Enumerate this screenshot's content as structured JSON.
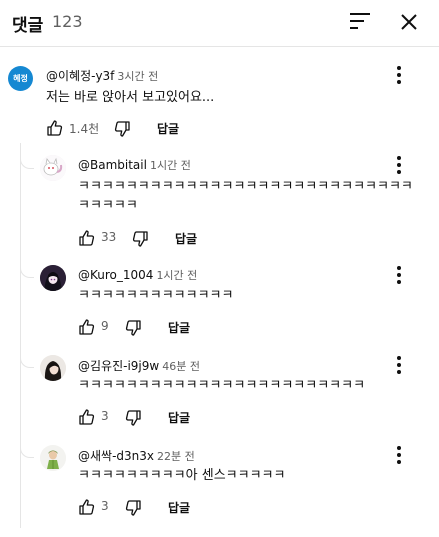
{
  "header": {
    "title": "댓글",
    "count": "123"
  },
  "main_comment": {
    "avatar_text": "혜정",
    "author": "@이혜정-y3f",
    "time": "3시간 전",
    "text": "저는 바로 앉아서 보고있어요...",
    "likes": "1.4천",
    "reply_label": "답글"
  },
  "replies": [
    {
      "author": "@Bambitail",
      "time": "1시간 전",
      "text_line1": "ㅋㅋㅋㅋㅋㅋㅋㅋㅋㅋㅋㅋㅋㅋㅋㅋㅋㅋㅋㅋㅋㅋㅋㅋㅋㅋㅋㅋ",
      "text_line2": "ㅋㅋㅋㅋㅋ",
      "likes": "33",
      "reply_label": "답글"
    },
    {
      "author": "@Kuro_1004",
      "time": "1시간 전",
      "text_line1": "ㅋㅋㅋㅋㅋㅋㅋㅋㅋㅋㅋㅋㅋ",
      "likes": "9",
      "reply_label": "답글"
    },
    {
      "author": "@김유진-i9j9w",
      "time": "46분 전",
      "text_line1": "ㅋㅋㅋㅋㅋㅋㅋㅋㅋㅋㅋㅋㅋㅋㅋㅋㅋㅋㅋㅋㅋㅋㅋㅋ",
      "likes": "3",
      "reply_label": "답글"
    },
    {
      "author": "@새싹-d3n3x",
      "time": "22분 전",
      "text_line1": "ㅋㅋㅋㅋㅋㅋㅋㅋㅋ아 센스ㅋㅋㅋㅋㅋ",
      "likes": "3",
      "reply_label": "답글"
    }
  ],
  "colors": {
    "accent_avatar": "#1588d2",
    "text_primary": "#0f0f0f",
    "text_secondary": "#606060",
    "divider": "#e5e5e5"
  },
  "icons": [
    "sort-icon",
    "close-icon",
    "like-icon",
    "dislike-icon",
    "more-vert-icon"
  ]
}
